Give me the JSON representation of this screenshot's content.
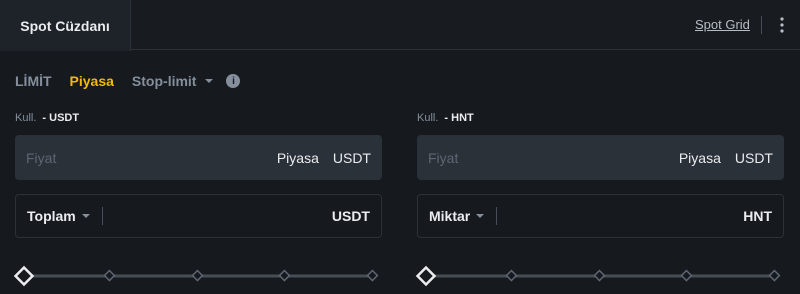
{
  "topbar": {
    "active_tab": "Spot Cüzdanı",
    "spot_grid_link": "Spot Grid"
  },
  "order_tabs": {
    "limit": "LİMİT",
    "market": "Piyasa",
    "stop_limit": "Stop-limit",
    "active": "Piyasa",
    "info_icon_glyph": "i"
  },
  "buy": {
    "avail_label": "Kull.",
    "avail_value": "- USDT",
    "price_placeholder": "Fiyat",
    "price_market": "Piyasa",
    "price_unit": "USDT",
    "amount_selector": "Toplam",
    "amount_unit": "USDT",
    "slider_percent": 0
  },
  "sell": {
    "avail_label": "Kull.",
    "avail_value": "- HNT",
    "price_placeholder": "Fiyat",
    "price_market": "Piyasa",
    "price_unit": "USDT",
    "amount_selector": "Miktar",
    "amount_unit": "HNT",
    "slider_percent": 0
  },
  "colors": {
    "background": "#161a1e",
    "accent": "#f0b90b",
    "input_bg": "#2b3139",
    "muted_text": "#848e9c"
  }
}
